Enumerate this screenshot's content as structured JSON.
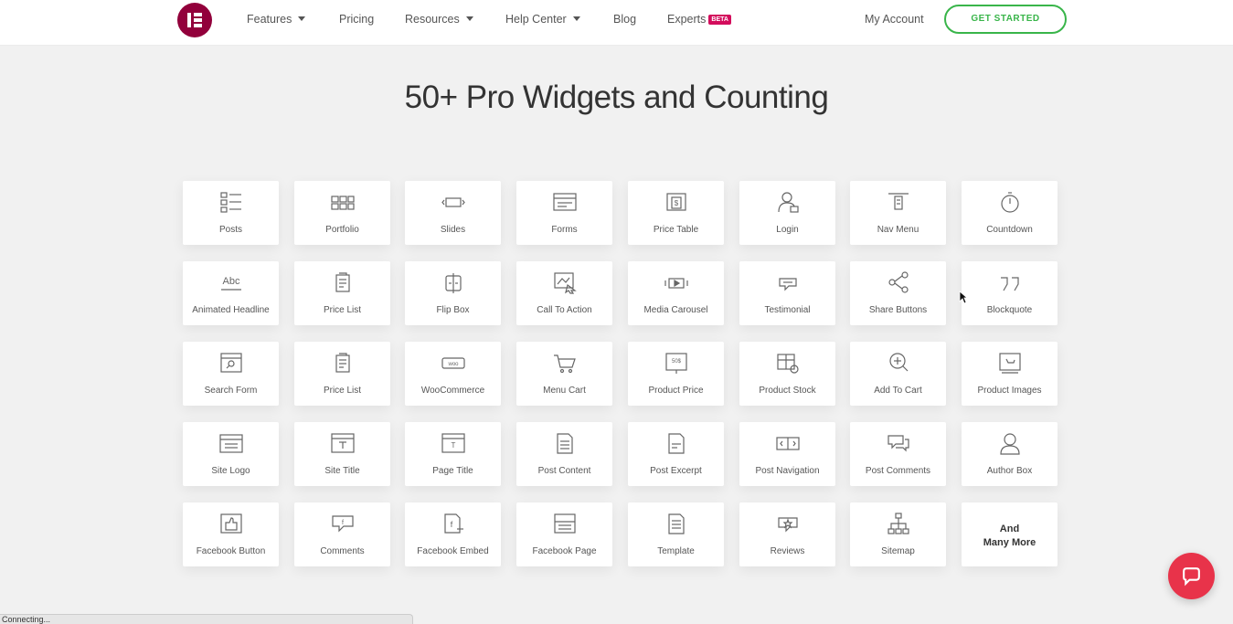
{
  "nav": {
    "features": "Features",
    "pricing": "Pricing",
    "resources": "Resources",
    "help_center": "Help Center",
    "blog": "Blog",
    "experts": "Experts",
    "beta": "BETA",
    "my_account": "My Account",
    "get_started": "GET STARTED"
  },
  "heading": "50+ Pro Widgets and Counting",
  "widgets": [
    {
      "label": "Posts",
      "icon": "list-icon"
    },
    {
      "label": "Portfolio",
      "icon": "grid-icon"
    },
    {
      "label": "Slides",
      "icon": "slides-icon"
    },
    {
      "label": "Forms",
      "icon": "form-icon"
    },
    {
      "label": "Price Table",
      "icon": "price-table-icon"
    },
    {
      "label": "Login",
      "icon": "user-lock-icon"
    },
    {
      "label": "Nav Menu",
      "icon": "nav-menu-icon"
    },
    {
      "label": "Countdown",
      "icon": "stopwatch-icon"
    },
    {
      "label": "Animated Headline",
      "icon": "abc-icon"
    },
    {
      "label": "Price List",
      "icon": "price-list-icon"
    },
    {
      "label": "Flip Box",
      "icon": "flip-box-icon"
    },
    {
      "label": "Call To Action",
      "icon": "call-to-action-icon"
    },
    {
      "label": "Media Carousel",
      "icon": "media-carousel-icon"
    },
    {
      "label": "Testimonial",
      "icon": "speech-bubble-icon"
    },
    {
      "label": "Share Buttons",
      "icon": "share-icon"
    },
    {
      "label": "Blockquote",
      "icon": "quote-icon"
    },
    {
      "label": "Search Form",
      "icon": "search-icon"
    },
    {
      "label": "Price List",
      "icon": "price-list-icon"
    },
    {
      "label": "WooCommerce",
      "icon": "woo-icon"
    },
    {
      "label": "Menu Cart",
      "icon": "cart-icon"
    },
    {
      "label": "Product Price",
      "icon": "product-price-icon"
    },
    {
      "label": "Product Stock",
      "icon": "product-stock-icon"
    },
    {
      "label": "Add To Cart",
      "icon": "add-to-cart-icon"
    },
    {
      "label": "Product Images",
      "icon": "product-images-icon"
    },
    {
      "label": "Site Logo",
      "icon": "site-logo-icon"
    },
    {
      "label": "Site Title",
      "icon": "site-title-icon"
    },
    {
      "label": "Page Title",
      "icon": "page-title-icon"
    },
    {
      "label": "Post Content",
      "icon": "post-content-icon"
    },
    {
      "label": "Post Excerpt",
      "icon": "post-excerpt-icon"
    },
    {
      "label": "Post Navigation",
      "icon": "post-navigation-icon"
    },
    {
      "label": "Post Comments",
      "icon": "comments-icon"
    },
    {
      "label": "Author Box",
      "icon": "author-icon"
    },
    {
      "label": "Facebook Button",
      "icon": "thumbs-up-icon"
    },
    {
      "label": "Comments",
      "icon": "comment-icon"
    },
    {
      "label": "Facebook Embed",
      "icon": "facebook-embed-icon"
    },
    {
      "label": "Facebook Page",
      "icon": "facebook-page-icon"
    },
    {
      "label": "Template",
      "icon": "template-icon"
    },
    {
      "label": "Reviews",
      "icon": "reviews-icon"
    },
    {
      "label": "Sitemap",
      "icon": "sitemap-icon"
    },
    {
      "label": "And Many More",
      "icon": ""
    }
  ],
  "more_line1": "And",
  "more_line2": "Many More",
  "status_text": "Connecting...",
  "colors": {
    "brand": "#92003b",
    "cta_green": "#39b54a",
    "chat_red": "#e8334a",
    "beta_badge": "#d30c5c"
  }
}
